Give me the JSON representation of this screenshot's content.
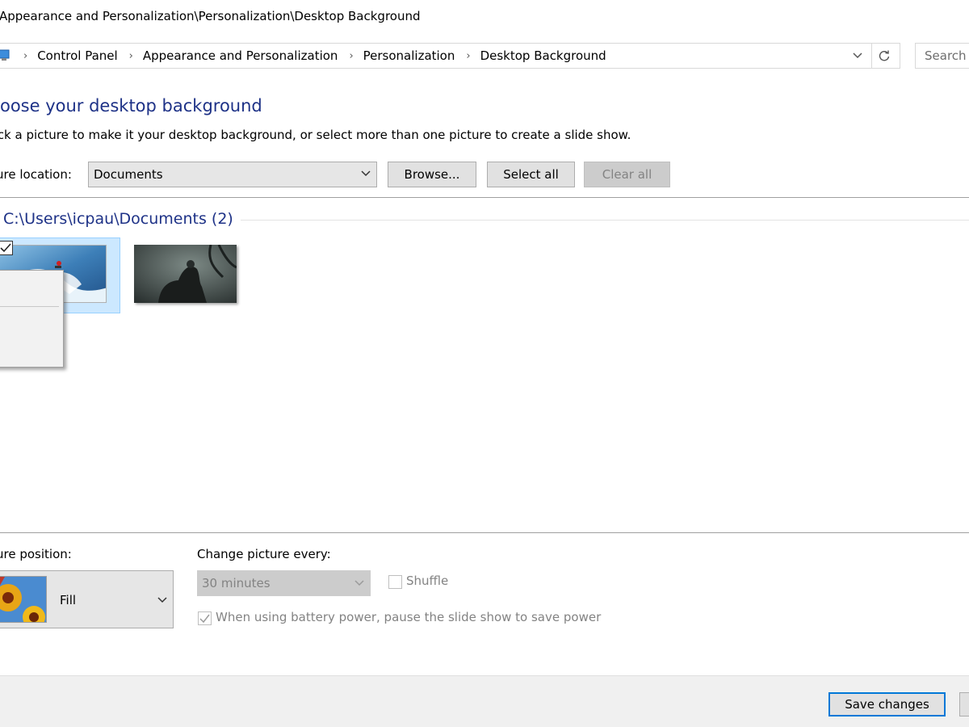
{
  "window": {
    "title": "Appearance and Personalization\\Personalization\\Desktop Background"
  },
  "address_bar": {
    "breadcrumbs": [
      "Control Panel",
      "Appearance and Personalization",
      "Personalization",
      "Desktop Background"
    ],
    "dropdown_icon": "chevron-down-icon",
    "refresh_icon": "refresh-icon"
  },
  "search": {
    "placeholder": "Search"
  },
  "main": {
    "heading": "Choose your desktop background",
    "subtext": "Click a picture to make it your desktop background, or select more than one picture to create a slide show."
  },
  "location": {
    "label": "Picture location:",
    "value": "Documents",
    "browse_label": "Browse...",
    "select_all_label": "Select all",
    "clear_all_label": "Clear all"
  },
  "group": {
    "header": "C:\\Users\\icpau\\Documents (2)",
    "items": [
      {
        "name": "surfer-wave",
        "selected": true,
        "checked": true
      },
      {
        "name": "dark-rider",
        "selected": false,
        "checked": false
      }
    ]
  },
  "position": {
    "label": "Picture position:",
    "value": "Fill"
  },
  "slideshow": {
    "change_label": "Change picture every:",
    "interval_value": "30 minutes",
    "shuffle_label": "Shuffle",
    "shuffle_checked": false,
    "battery_label": "When using battery power, pause the slide show to save power",
    "battery_checked": true
  },
  "footer": {
    "save_label": "Save changes"
  },
  "colors": {
    "heading": "#1e3287",
    "accent": "#0078d7",
    "selection": "#cce8ff"
  }
}
